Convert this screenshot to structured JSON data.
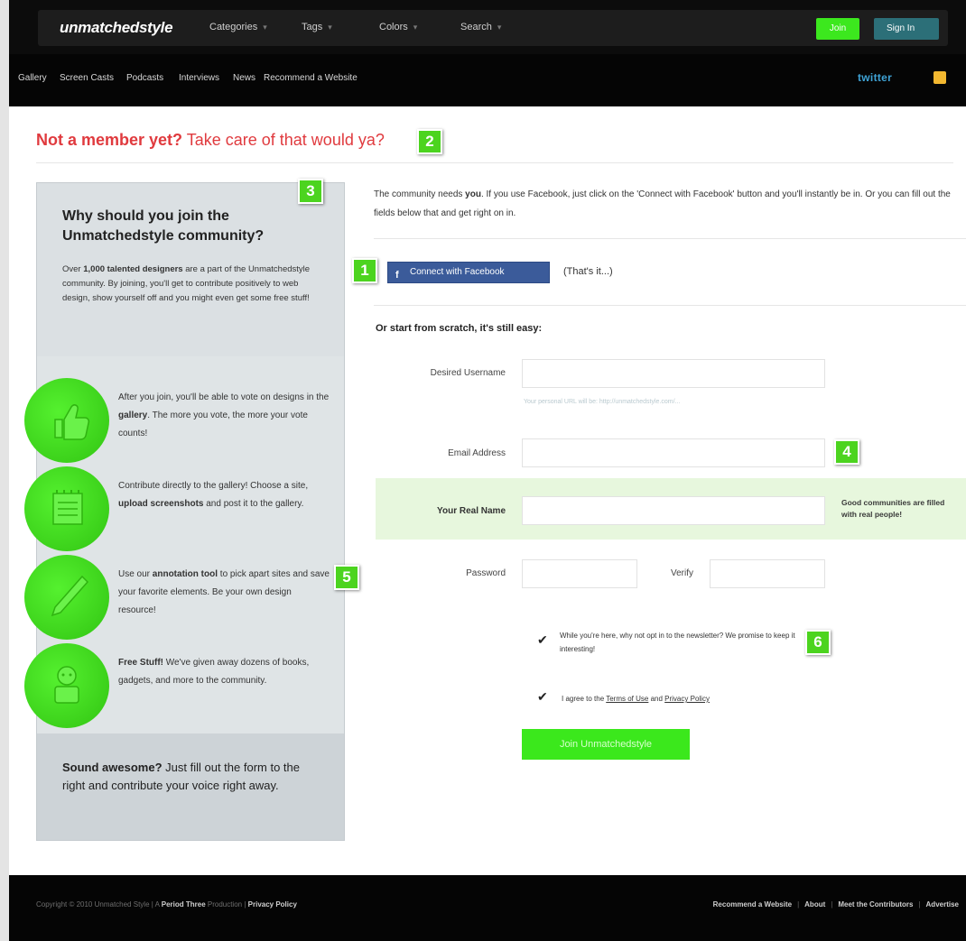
{
  "header": {
    "logo": "unmatchedstyle",
    "nav": [
      {
        "label": "Categories"
      },
      {
        "label": "Tags"
      },
      {
        "label": "Colors"
      },
      {
        "label": "Search"
      }
    ],
    "join_label": "Join",
    "signin_label": "Sign In"
  },
  "subnav": {
    "items": [
      "Gallery",
      "Screen Casts",
      "Podcasts",
      "Interviews",
      "News",
      "Recommend a Website"
    ],
    "twitter_label": "twitter"
  },
  "heading": {
    "bold": "Not a member yet?",
    "light": "Take care of that would ya?"
  },
  "sidebar": {
    "title": "Why should you join the Unmatchedstyle community?",
    "intro_prefix": "Over ",
    "intro_strong": "1,000 talented designers",
    "intro_suffix": " are a part of the Unmatchedstyle community. By joining, you'll get to contribute positively to web design, show yourself off and you might even get some free stuff!",
    "features": [
      {
        "icon": "thumbs-up-icon",
        "a": "After you join, you'll be able to vote on designs in the ",
        "b": "gallery",
        "c": ". The more you vote, the more your vote counts!"
      },
      {
        "icon": "notepad-icon",
        "a": "Contribute directly to the gallery! Choose a site, ",
        "b": "upload screenshots",
        "c": " and post it to the gallery."
      },
      {
        "icon": "pen-icon",
        "a": "Use our ",
        "b": "annotation tool",
        "c": " to pick apart sites and save your favorite elements. Be your own design resource!"
      },
      {
        "icon": "gift-icon",
        "a": "",
        "b": "Free Stuff!",
        "c": " We've given away dozens of books, gadgets, and more to the community."
      }
    ],
    "bottom_strong": "Sound awesome?",
    "bottom_rest": " Just fill out the form to the right and contribute your voice right away."
  },
  "main": {
    "intro_a": "The community needs ",
    "intro_b": "you",
    "intro_c": ". If you use Facebook, just click on the 'Connect with Facebook' button and you'll instantly be in. Or you can fill out the fields below that and get right on in.",
    "fb_button": "Connect with Facebook",
    "fb_note": "(That's it...)",
    "scratch_heading": "Or start from scratch, it's still easy:",
    "fields": {
      "username_label": "Desired Username",
      "username_hint": "Your personal URL will be: http://unmatchedstyle.com/...",
      "email_label": "Email Address",
      "realname_label": "Your Real Name",
      "realname_note": "Good communities are filled with real people!",
      "password_label": "Password",
      "verify_label": "Verify"
    },
    "newsletter_text": "While you're here, why not opt in to the newsletter? We promise to keep it interesting!",
    "newsletter_checked": true,
    "terms_prefix": "I agree to the ",
    "terms_link": "Terms of Use",
    "terms_and": " and ",
    "privacy_link": "Privacy Policy",
    "terms_checked": true,
    "submit_label": "Join Unmatchedstyle"
  },
  "badges": [
    "1",
    "2",
    "3",
    "4",
    "5",
    "6"
  ],
  "footer": {
    "copyright": "Copyright © 2010 Unmatched Style",
    "sep": " | ",
    "a_text": "A ",
    "period_three": "Period Three",
    "production": " Production",
    "privacy": "Privacy Policy",
    "links": [
      "Recommend a Website",
      "About",
      "Meet the Contributors",
      "Advertise"
    ]
  },
  "colors": {
    "accent_green": "#3ce81e",
    "heading_red": "#e03a3e",
    "facebook_blue": "#3b5b9a",
    "twitter_blue": "#3fa3d6"
  }
}
